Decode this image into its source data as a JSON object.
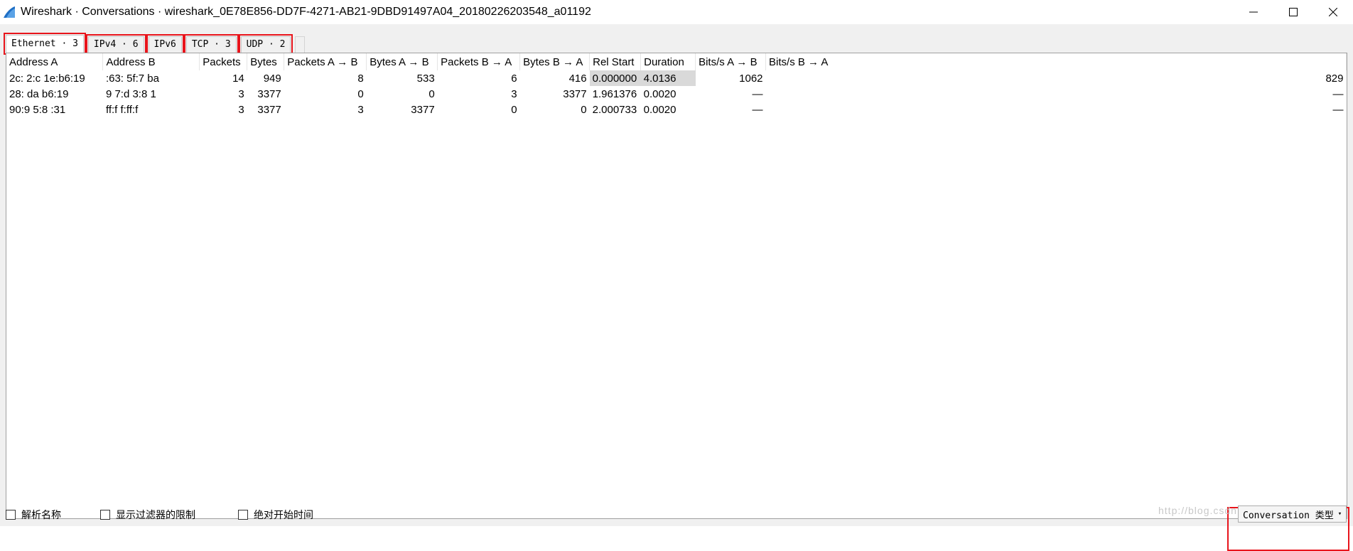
{
  "window": {
    "title": "Wireshark · Conversations · wireshark_0E78E856-DD7F-4271-AB21-9DBD91497A04_20180226203548_a01192"
  },
  "tabs": [
    {
      "label": "Ethernet · 3"
    },
    {
      "label": "IPv4 · 6"
    },
    {
      "label": "IPv6"
    },
    {
      "label": "TCP · 3"
    },
    {
      "label": "UDP · 2"
    }
  ],
  "columns": [
    "Address A",
    "Address B",
    "Packets",
    "Bytes",
    "Packets A → B",
    "Bytes A → B",
    "Packets B → A",
    "Bytes B → A",
    "Rel Start",
    "Duration",
    "Bits/s A → B",
    "Bits/s B → A"
  ],
  "rows": [
    [
      "2c:  2:c   1e:b6:19",
      "  :63:    5f:7   ba",
      "14",
      "949",
      "8",
      "533",
      "6",
      "416",
      "0.000000",
      "4.0136",
      "1062",
      "829"
    ],
    [
      "28:     da     b6:19",
      "9     7:d    3:8    1",
      "3",
      "3377",
      "0",
      "0",
      "3",
      "3377",
      "1.961376",
      "0.0020",
      "—",
      "—"
    ],
    [
      "90:9    5:8    :31",
      "ff:f     f:ff:f",
      "3",
      "3377",
      "3",
      "3377",
      "0",
      "0",
      "2.000733",
      "0.0020",
      "—",
      "—"
    ]
  ],
  "bottom": {
    "resolve_names": "解析名称",
    "limit_to_filter": "显示过滤器的限制",
    "absolute_start": "绝对开始时间",
    "watermark": "http://blog.csdn.net/",
    "conv_type_button": "Conversation 类型"
  }
}
